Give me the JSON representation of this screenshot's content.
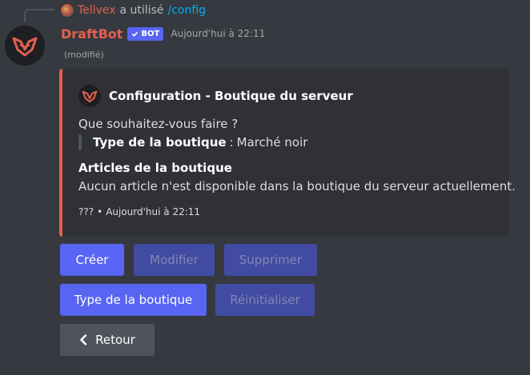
{
  "reply": {
    "username": "Tellvex",
    "text": "a utilisé",
    "command": "/config",
    "avatar_icon": "user-avatar-icon"
  },
  "message": {
    "username": "DraftBot",
    "bot_tag": "BOT",
    "timestamp": "Aujourd'hui à 22:11",
    "edited": "(modifié)",
    "avatar_icon": "draftbot-logo-icon",
    "name_color": "#e4604f"
  },
  "embed": {
    "accent_color": "#e4604f",
    "author": "Configuration - Boutique du serveur",
    "description": "Que souhaitez-vous faire ?",
    "quote_key": "Type de la boutique",
    "quote_sep": ":",
    "quote_value": "Marché noir",
    "field_name": "Articles de la boutique",
    "field_value": "Aucun article n'est disponible dans la boutique du serveur actuellement.",
    "footer_text": "???",
    "footer_dot": "•",
    "footer_time": "Aujourd'hui à 22:11"
  },
  "buttons": {
    "create": "Créer",
    "edit": "Modifier",
    "delete": "Supprimer",
    "shop_type": "Type de la boutique",
    "reset": "Réinitialiser",
    "back": "Retour"
  },
  "colors": {
    "blurple": "#5865f2",
    "secondary": "#4f545c",
    "background": "#36393f",
    "embed_bg": "#2f3136"
  }
}
